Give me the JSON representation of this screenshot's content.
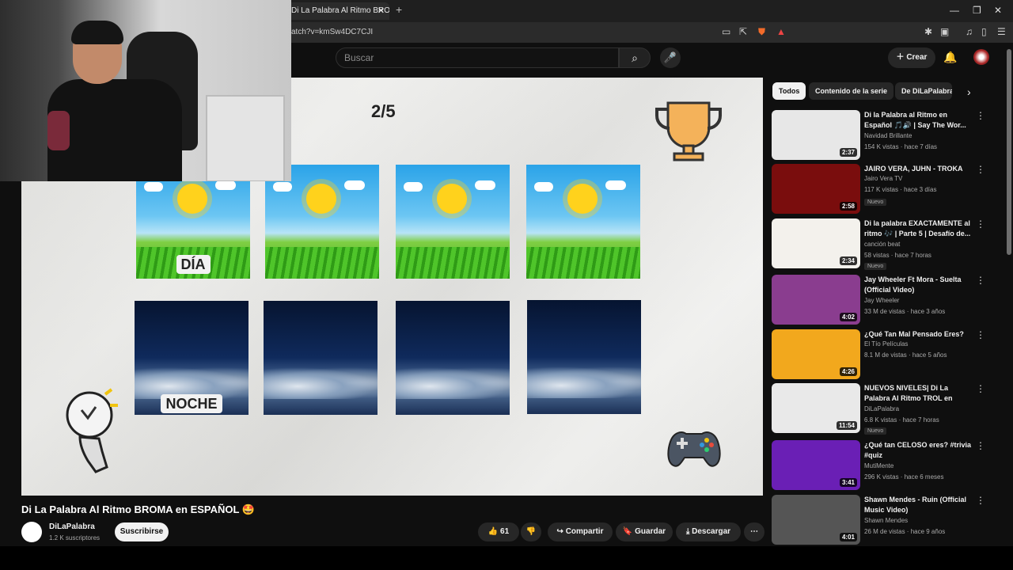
{
  "browser": {
    "tab_title": "Di La Palabra Al Ritmo BROMA",
    "tab_close": "✕",
    "new_tab": "+",
    "url": "atch?v=kmSw4DC7CJI",
    "win_min": "—",
    "win_max": "❐",
    "win_close": "✕"
  },
  "header": {
    "search_placeholder": "Buscar",
    "create_label": "Crear"
  },
  "video": {
    "counter": "2/5",
    "top_row_label": "DÍA",
    "bottom_row_label": "NOCHE",
    "title": "Di La Palabra Al Ritmo BROMA en ESPAÑOL 🤩",
    "channel": "DiLaPalabra",
    "subscribers": "1.2 K suscriptores",
    "subscribe_label": "Suscribirse",
    "likes": "61",
    "share_label": "Compartir",
    "save_label": "Guardar",
    "download_label": "Descargar"
  },
  "sidebar": {
    "chips": [
      "Todos",
      "Contenido de la serie",
      "De DiLaPalabra"
    ],
    "items": [
      {
        "title": "Di la Palabra al Ritmo en Español 🎵🔊 | Say The Wor...",
        "channel": "Navidad Brillante",
        "meta": "154 K vistas · hace 7 días",
        "duration": "2:37",
        "badge": "",
        "thumb": "#e7e7e7"
      },
      {
        "title": "JAIRO VERA, JUHN - TROKA",
        "channel": "Jairo Vera TV",
        "meta": "117 K vistas · hace 3 días",
        "duration": "2:58",
        "badge": "Nuevo",
        "thumb": "#7a0d0d"
      },
      {
        "title": "Di la palabra EXACTAMENTE al ritmo 🎶 | Parte 5 | Desafío de...",
        "channel": "canción beat",
        "meta": "58 vistas · hace 7 horas",
        "duration": "2:34",
        "badge": "Nuevo",
        "thumb": "#f3f1ec"
      },
      {
        "title": "Jay Wheeler Ft Mora - Suelta (Official Video)",
        "channel": "Jay Wheeler",
        "meta": "33 M de vistas · hace 3 años",
        "duration": "4:02",
        "badge": "",
        "thumb": "#8a3d8f"
      },
      {
        "title": "¿Qué Tan Mal Pensado Eres?",
        "channel": "El Tío Películas",
        "meta": "8.1 M de vistas · hace 5 años",
        "duration": "4:26",
        "badge": "",
        "thumb": "#f2a81d"
      },
      {
        "title": "NUEVOS NIVELES| Di La Palabra Al Ritmo TROL en ESPAÑOL ...",
        "channel": "DiLaPalabra",
        "meta": "6.8 K vistas · hace 7 horas",
        "duration": "11:54",
        "badge": "Nuevo",
        "thumb": "#e9e9e9"
      },
      {
        "title": "¿Qué tan CELOSO eres? #trivia #quiz",
        "channel": "MutiMente",
        "meta": "296 K vistas · hace 6 meses",
        "duration": "3:41",
        "badge": "",
        "thumb": "#6a1fb5"
      },
      {
        "title": "Shawn Mendes - Ruin (Official Music Video)",
        "channel": "Shawn Mendes",
        "meta": "26 M de vistas · hace 9 años",
        "duration": "4:01",
        "badge": "",
        "thumb": "#555555"
      }
    ]
  }
}
